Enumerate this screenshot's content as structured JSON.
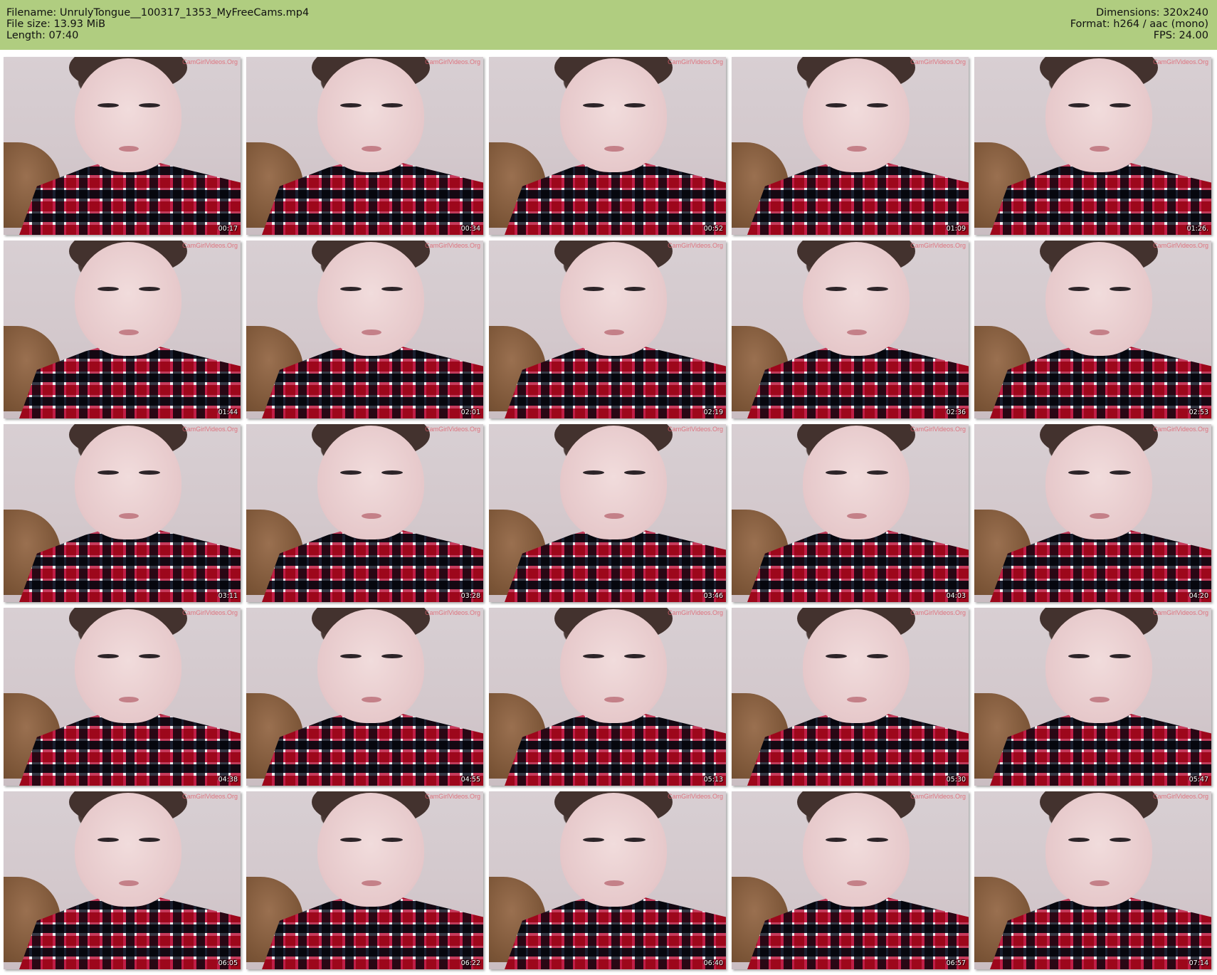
{
  "header": {
    "filename": "Filename: UnrulyTongue__100317_1353_MyFreeCams.mp4",
    "filesize": "File size: 13.93 MiB",
    "length": "Length: 07:40",
    "dimensions": "Dimensions: 320x240",
    "format": "Format: h264 / aac (mono)",
    "fps": "FPS: 24.00"
  },
  "watermark": "CamGirlVideos.Org",
  "thumbnails": [
    {
      "time": "00:17"
    },
    {
      "time": "00:34"
    },
    {
      "time": "00:52"
    },
    {
      "time": "01:09"
    },
    {
      "time": "01:26."
    },
    {
      "time": "01:44"
    },
    {
      "time": "02:01"
    },
    {
      "time": "02:19"
    },
    {
      "time": "02:36"
    },
    {
      "time": "02:53"
    },
    {
      "time": "03:11"
    },
    {
      "time": "03:28"
    },
    {
      "time": "03:46"
    },
    {
      "time": "04:03"
    },
    {
      "time": "04:20"
    },
    {
      "time": "04:38"
    },
    {
      "time": "04:55"
    },
    {
      "time": "05:13"
    },
    {
      "time": "05:30"
    },
    {
      "time": "05:47"
    },
    {
      "time": "06:05"
    },
    {
      "time": "06:22"
    },
    {
      "time": "06:40"
    },
    {
      "time": "06:57"
    },
    {
      "time": "07:14"
    }
  ]
}
